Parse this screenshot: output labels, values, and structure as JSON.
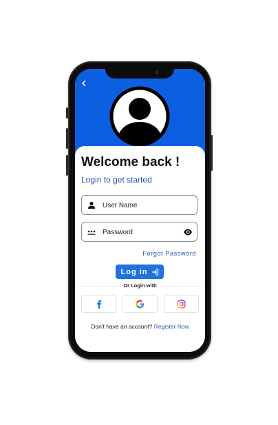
{
  "header": {
    "back_icon": "chevron-left-icon",
    "avatar_icon": "user-avatar-icon",
    "color": "#0b5fe0"
  },
  "title": "Welcome back !",
  "subtitle": "Login to get started",
  "fields": {
    "username": {
      "placeholder": "User Name",
      "icon": "person-icon"
    },
    "password": {
      "placeholder": "Password",
      "icon": "password-dots-icon",
      "toggle_icon": "eye-icon"
    }
  },
  "forgot_password": "Forgot Password",
  "login_button": {
    "label": "Log in",
    "icon": "login-arrow-icon",
    "color": "#1f73dc"
  },
  "or_login_with": "Or Login with",
  "social": [
    "facebook-icon",
    "google-icon",
    "instagram-icon"
  ],
  "footer": {
    "text": "Don't have an account?",
    "link": "Register Now"
  }
}
